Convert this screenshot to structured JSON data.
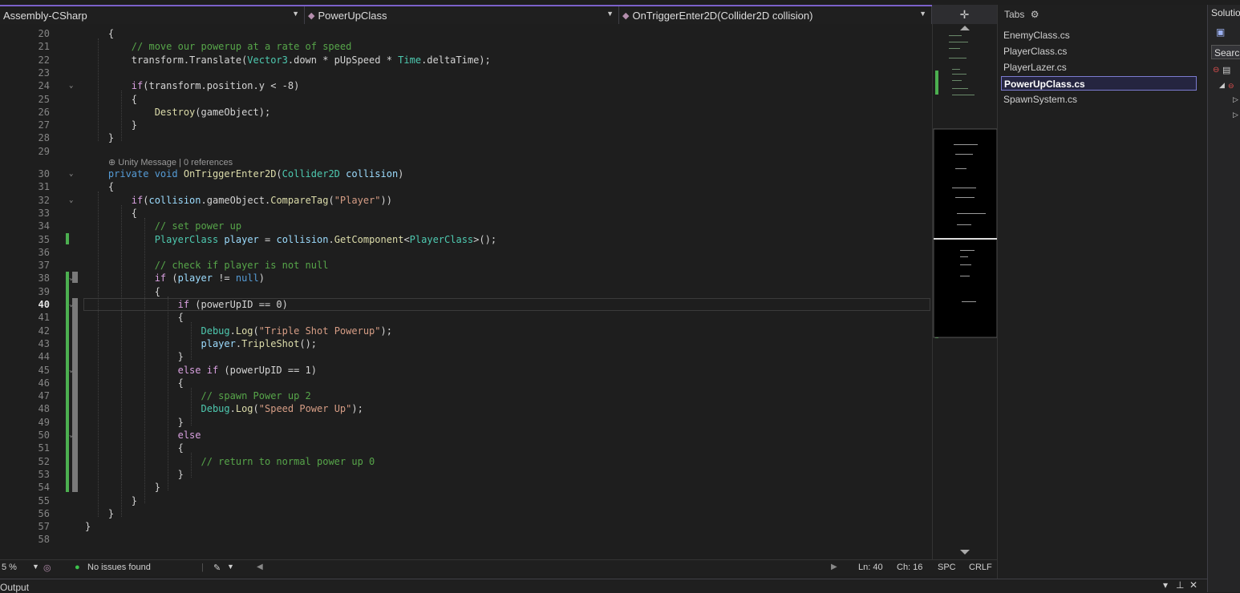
{
  "toolbar": {
    "project": "Assembly-CSharp",
    "class": "PowerUpClass",
    "method": "OnTriggerEnter2D(Collider2D collision)"
  },
  "codelens": "Unity Message | 0 references",
  "lines": [
    {
      "n": "20",
      "code": [
        [
          "p",
          "    {"
        ]
      ]
    },
    {
      "n": "21",
      "code": [
        [
          "p",
          "        "
        ],
        [
          "cm",
          "// move our powerup at a rate of speed"
        ]
      ]
    },
    {
      "n": "22",
      "code": [
        [
          "p",
          "        transform.Translate("
        ],
        [
          "ty",
          "Vector3"
        ],
        [
          "p",
          ".down * pUpSpeed * "
        ],
        [
          "ty",
          "Time"
        ],
        [
          "p",
          ".deltaTime);"
        ]
      ]
    },
    {
      "n": "23",
      "code": []
    },
    {
      "n": "24",
      "code": [
        [
          "p",
          "        "
        ],
        [
          "ctl",
          "if"
        ],
        [
          "p",
          "(transform.position.y < -8)"
        ]
      ]
    },
    {
      "n": "25",
      "code": [
        [
          "p",
          "        {"
        ]
      ]
    },
    {
      "n": "26",
      "code": [
        [
          "p",
          "            "
        ],
        [
          "fn",
          "Destroy"
        ],
        [
          "p",
          "(gameObject);"
        ]
      ]
    },
    {
      "n": "27",
      "code": [
        [
          "p",
          "        }"
        ]
      ]
    },
    {
      "n": "28",
      "code": [
        [
          "p",
          "    }"
        ]
      ]
    },
    {
      "n": "29",
      "code": []
    },
    {
      "n": "30",
      "code": [
        [
          "p",
          "    "
        ],
        [
          "kw",
          "private void "
        ],
        [
          "fn",
          "OnTriggerEnter2D"
        ],
        [
          "p",
          "("
        ],
        [
          "ty",
          "Collider2D"
        ],
        [
          "p",
          " "
        ],
        [
          "id",
          "collision"
        ],
        [
          "p",
          ")"
        ]
      ]
    },
    {
      "n": "31",
      "code": [
        [
          "p",
          "    {"
        ]
      ]
    },
    {
      "n": "32",
      "code": [
        [
          "p",
          "        "
        ],
        [
          "ctl",
          "if"
        ],
        [
          "p",
          "("
        ],
        [
          "id",
          "collision"
        ],
        [
          "p",
          ".gameObject."
        ],
        [
          "fn",
          "CompareTag"
        ],
        [
          "p",
          "("
        ],
        [
          "str",
          "\"Player\""
        ],
        [
          "p",
          "))"
        ]
      ]
    },
    {
      "n": "33",
      "code": [
        [
          "p",
          "        {"
        ]
      ]
    },
    {
      "n": "34",
      "code": [
        [
          "p",
          "            "
        ],
        [
          "cm",
          "// set power up"
        ]
      ]
    },
    {
      "n": "35",
      "code": [
        [
          "p",
          "            "
        ],
        [
          "ty",
          "PlayerClass"
        ],
        [
          "p",
          " "
        ],
        [
          "id",
          "player"
        ],
        [
          "p",
          " = "
        ],
        [
          "id",
          "collision"
        ],
        [
          "p",
          "."
        ],
        [
          "fn",
          "GetComponent"
        ],
        [
          "p",
          "<"
        ],
        [
          "ty",
          "PlayerClass"
        ],
        [
          "p",
          ">();"
        ]
      ]
    },
    {
      "n": "36",
      "code": []
    },
    {
      "n": "37",
      "code": [
        [
          "p",
          "            "
        ],
        [
          "cm",
          "// check if player is not null"
        ]
      ]
    },
    {
      "n": "38",
      "code": [
        [
          "p",
          "            "
        ],
        [
          "ctl",
          "if"
        ],
        [
          "p",
          " ("
        ],
        [
          "id",
          "player"
        ],
        [
          "p",
          " != "
        ],
        [
          "kw",
          "null"
        ],
        [
          "p",
          ")"
        ]
      ]
    },
    {
      "n": "39",
      "code": [
        [
          "p",
          "            {"
        ]
      ]
    },
    {
      "n": "40",
      "code": [
        [
          "p",
          "                "
        ],
        [
          "ctl",
          "if"
        ],
        [
          "p",
          " (powerUpID == 0)"
        ]
      ]
    },
    {
      "n": "41",
      "code": [
        [
          "p",
          "                {"
        ]
      ]
    },
    {
      "n": "42",
      "code": [
        [
          "p",
          "                    "
        ],
        [
          "ty",
          "Debug"
        ],
        [
          "p",
          "."
        ],
        [
          "fn",
          "Log"
        ],
        [
          "p",
          "("
        ],
        [
          "str",
          "\"Triple Shot Powerup\""
        ],
        [
          "p",
          ");"
        ]
      ]
    },
    {
      "n": "43",
      "code": [
        [
          "p",
          "                    "
        ],
        [
          "id",
          "player"
        ],
        [
          "p",
          "."
        ],
        [
          "fn",
          "TripleShot"
        ],
        [
          "p",
          "();"
        ]
      ]
    },
    {
      "n": "44",
      "code": [
        [
          "p",
          "                }"
        ]
      ]
    },
    {
      "n": "45",
      "code": [
        [
          "p",
          "                "
        ],
        [
          "ctl",
          "else if"
        ],
        [
          "p",
          " (powerUpID == 1)"
        ]
      ]
    },
    {
      "n": "46",
      "code": [
        [
          "p",
          "                {"
        ]
      ]
    },
    {
      "n": "47",
      "code": [
        [
          "p",
          "                    "
        ],
        [
          "cm",
          "// spawn Power up 2"
        ]
      ]
    },
    {
      "n": "48",
      "code": [
        [
          "p",
          "                    "
        ],
        [
          "ty",
          "Debug"
        ],
        [
          "p",
          "."
        ],
        [
          "fn",
          "Log"
        ],
        [
          "p",
          "("
        ],
        [
          "str",
          "\"Speed Power Up\""
        ],
        [
          "p",
          ");"
        ]
      ]
    },
    {
      "n": "49",
      "code": [
        [
          "p",
          "                }"
        ]
      ]
    },
    {
      "n": "50",
      "code": [
        [
          "p",
          "                "
        ],
        [
          "ctl",
          "else"
        ]
      ]
    },
    {
      "n": "51",
      "code": [
        [
          "p",
          "                {"
        ]
      ]
    },
    {
      "n": "52",
      "code": [
        [
          "p",
          "                    "
        ],
        [
          "cm",
          "// return to normal power up 0"
        ]
      ]
    },
    {
      "n": "53",
      "code": [
        [
          "p",
          "                }"
        ]
      ]
    },
    {
      "n": "54",
      "code": [
        [
          "p",
          "            }"
        ]
      ]
    },
    {
      "n": "55",
      "code": [
        [
          "p",
          "        }"
        ]
      ]
    },
    {
      "n": "56",
      "code": [
        [
          "p",
          "    }"
        ]
      ]
    },
    {
      "n": "57",
      "code": [
        [
          "p",
          "}"
        ]
      ]
    },
    {
      "n": "58",
      "code": []
    }
  ],
  "tabs": {
    "title": "Tabs",
    "items": [
      "EnemyClass.cs",
      "PlayerClass.cs",
      "PlayerLazer.cs",
      "PowerUpClass.cs",
      "SpawnSystem.cs"
    ],
    "active_index": 3
  },
  "solution": {
    "title": "Solutio",
    "search": "Search"
  },
  "status": {
    "zoom": "5 %",
    "issues": "No issues found",
    "ln": "Ln: 40",
    "ch": "Ch: 16",
    "spc": "SPC",
    "crlf": "CRLF"
  },
  "output": {
    "title": "Output"
  },
  "colors": {
    "accent": "#7b61c9",
    "change": "#4caf50"
  }
}
